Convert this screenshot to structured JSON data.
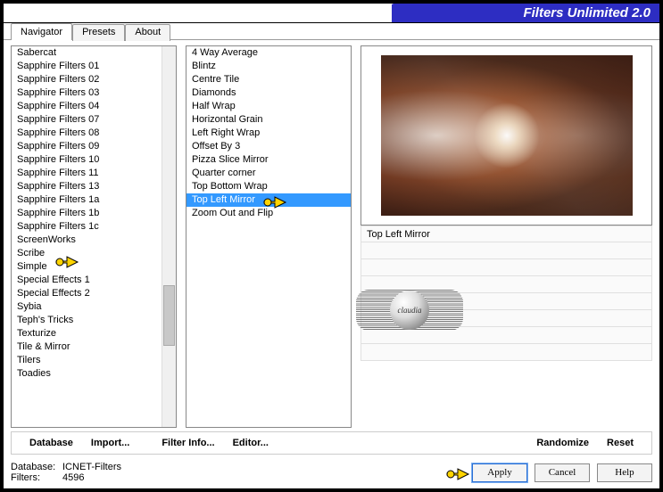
{
  "banner": {
    "title": "Filters Unlimited 2.0"
  },
  "tabs": [
    "Navigator",
    "Presets",
    "About"
  ],
  "categories": [
    "Sabercat",
    "Sapphire Filters 01",
    "Sapphire Filters 02",
    "Sapphire Filters 03",
    "Sapphire Filters 04",
    "Sapphire Filters 07",
    "Sapphire Filters 08",
    "Sapphire Filters 09",
    "Sapphire Filters 10",
    "Sapphire Filters 11",
    "Sapphire Filters 13",
    "Sapphire Filters 1a",
    "Sapphire Filters 1b",
    "Sapphire Filters 1c",
    "ScreenWorks",
    "Scribe",
    "Simple",
    "Special Effects 1",
    "Special Effects 2",
    "Sybia",
    "Teph's Tricks",
    "Texturize",
    "Tile & Mirror",
    "Tilers",
    "Toadies"
  ],
  "category_selected": "Simple",
  "filters": [
    "4 Way Average",
    "Blintz",
    "Centre Tile",
    "Diamonds",
    "Half Wrap",
    "Horizontal Grain",
    "Left Right Wrap",
    "Offset By 3",
    "Pizza Slice Mirror",
    "Quarter corner",
    "Top Bottom Wrap",
    "Top Left Mirror",
    "Zoom Out and Flip"
  ],
  "filter_selected": "Top Left Mirror",
  "param_label": "Top Left Mirror",
  "buttons": {
    "database": "Database",
    "import": "Import...",
    "filterinfo": "Filter Info...",
    "editor": "Editor...",
    "randomize": "Randomize",
    "reset": "Reset",
    "apply": "Apply",
    "cancel": "Cancel",
    "help": "Help"
  },
  "status": {
    "db_label": "Database:",
    "db_value": "ICNET-Filters",
    "filters_label": "Filters:",
    "filters_value": "4596"
  },
  "watermark": "claudia"
}
